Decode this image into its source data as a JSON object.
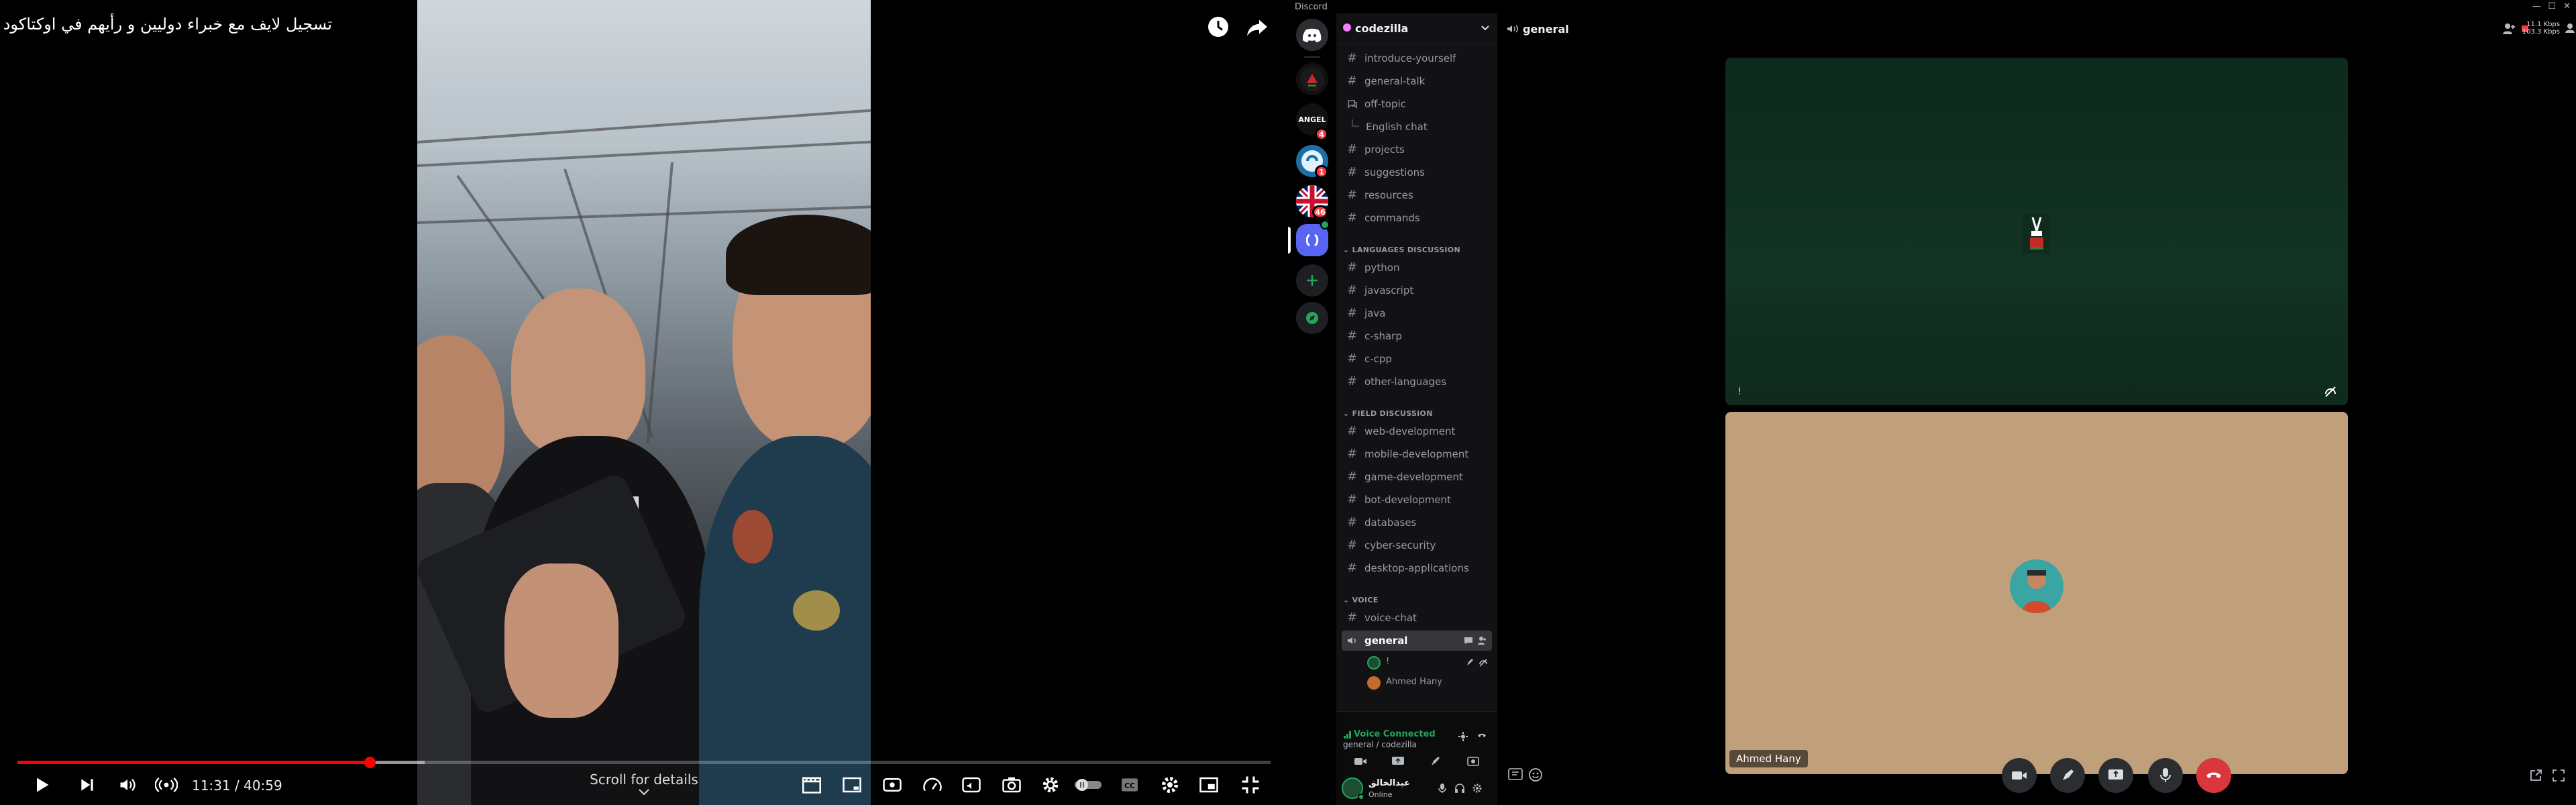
{
  "youtube": {
    "title": "تسجيل لايف مع خبراء دوليين و رأيهم في اوكتاكود",
    "time_current": "11:31",
    "time_total": "40:59",
    "time_display": "11:31 / 40:59",
    "progress_played": 0.281,
    "progress_loaded": 0.325,
    "scroll_details_label": "Scroll for details",
    "accent_color": "#ff0000",
    "icons": {
      "watch_later": "clock-icon",
      "share": "share-arrow-icon",
      "play": "play-icon",
      "next": "skip-next-icon",
      "volume": "volume-icon",
      "live": "live-broadcast-icon",
      "chapters": "clapperboard-icon",
      "miniplayer_frame": "frame-icon",
      "ambient": "ambient-icon",
      "speed": "speed-icon",
      "stable_volume": "stable-volume-icon",
      "screenshot": "camera-icon",
      "settings": "gear-icon",
      "autoplay": "autoplay-toggle-icon",
      "subtitles": "cc-icon",
      "miniplayer": "miniplayer-icon",
      "exit_fullscreen": "exit-fullscreen-icon"
    }
  },
  "discord": {
    "app_name": "Discord",
    "window_controls": [
      "—",
      "☐",
      "✕"
    ],
    "servers": [
      {
        "name": "discord-home",
        "badge": ""
      },
      {
        "name": "server-1",
        "badge": ""
      },
      {
        "name": "ANGEL",
        "badge": "4"
      },
      {
        "name": "server-3",
        "badge": "1"
      },
      {
        "name": "server-4",
        "badge": "46"
      },
      {
        "name": "codezilla",
        "badge": ""
      }
    ],
    "guild_name": "codezilla",
    "channels_top": [
      {
        "name": "introduce-yourself",
        "type": "text"
      },
      {
        "name": "general-talk",
        "type": "text"
      },
      {
        "name": "off-topic",
        "type": "forum"
      },
      {
        "name": "English chat",
        "type": "thread"
      },
      {
        "name": "projects",
        "type": "text"
      },
      {
        "name": "suggestions",
        "type": "text"
      },
      {
        "name": "resources",
        "type": "text"
      },
      {
        "name": "commands",
        "type": "text"
      }
    ],
    "categories": [
      {
        "name": "LANGUAGES DISCUSSION",
        "channels": [
          "python",
          "javascript",
          "java",
          "c-sharp",
          "c-cpp",
          "other-languages"
        ]
      },
      {
        "name": "FIELD DISCUSSION",
        "channels": [
          "web-development",
          "mobile-development",
          "game-development",
          "bot-development",
          "databases",
          "cyber-security",
          "desktop-applications"
        ]
      },
      {
        "name": "VOICE",
        "channels": [
          "voice-chat",
          "general"
        ]
      }
    ],
    "voice_users": [
      {
        "name": "!"
      },
      {
        "name": "Ahmed Hany"
      }
    ],
    "voice_status": {
      "label": "Voice Connected",
      "location": "general / codezilla",
      "color": "#23a55a"
    },
    "user_panel": {
      "display_name": "عبدالخالق",
      "status": "Online"
    },
    "main": {
      "channel_name": "general",
      "net_stats_up": "11.1 Kbps",
      "net_stats_down": "103.3 Kbps",
      "tile_1_corner_label": "!",
      "tile_2_name": "Ahmed Hany",
      "hangup_color": "#da373c"
    }
  }
}
